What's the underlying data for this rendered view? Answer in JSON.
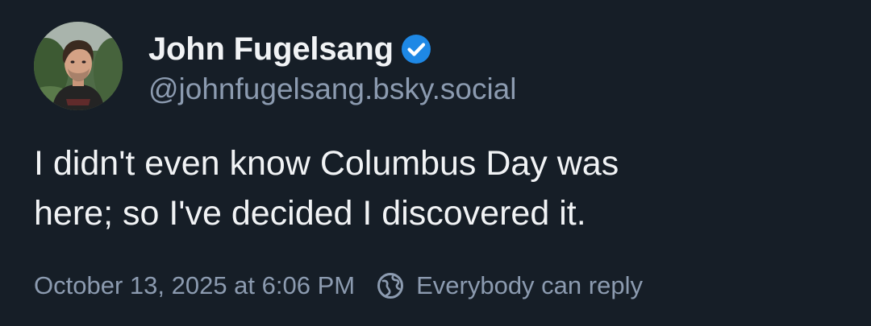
{
  "post": {
    "author": {
      "display_name": "John Fugelsang",
      "handle": "@johnfugelsang.bsky.social",
      "verified": true
    },
    "text": "I didn't even know Columbus Day was\nhere; so I've decided I discovered it.",
    "timestamp": "October 13, 2025 at 6:06 PM",
    "reply_setting": "Everybody can reply"
  },
  "colors": {
    "background": "#161e27",
    "primary_text": "#f1f3f5",
    "secondary_text": "#8c9bb0",
    "verified_badge": "#1e88e5"
  },
  "icons": {
    "verified": "verified-check-icon",
    "reply_setting": "earth-icon"
  }
}
